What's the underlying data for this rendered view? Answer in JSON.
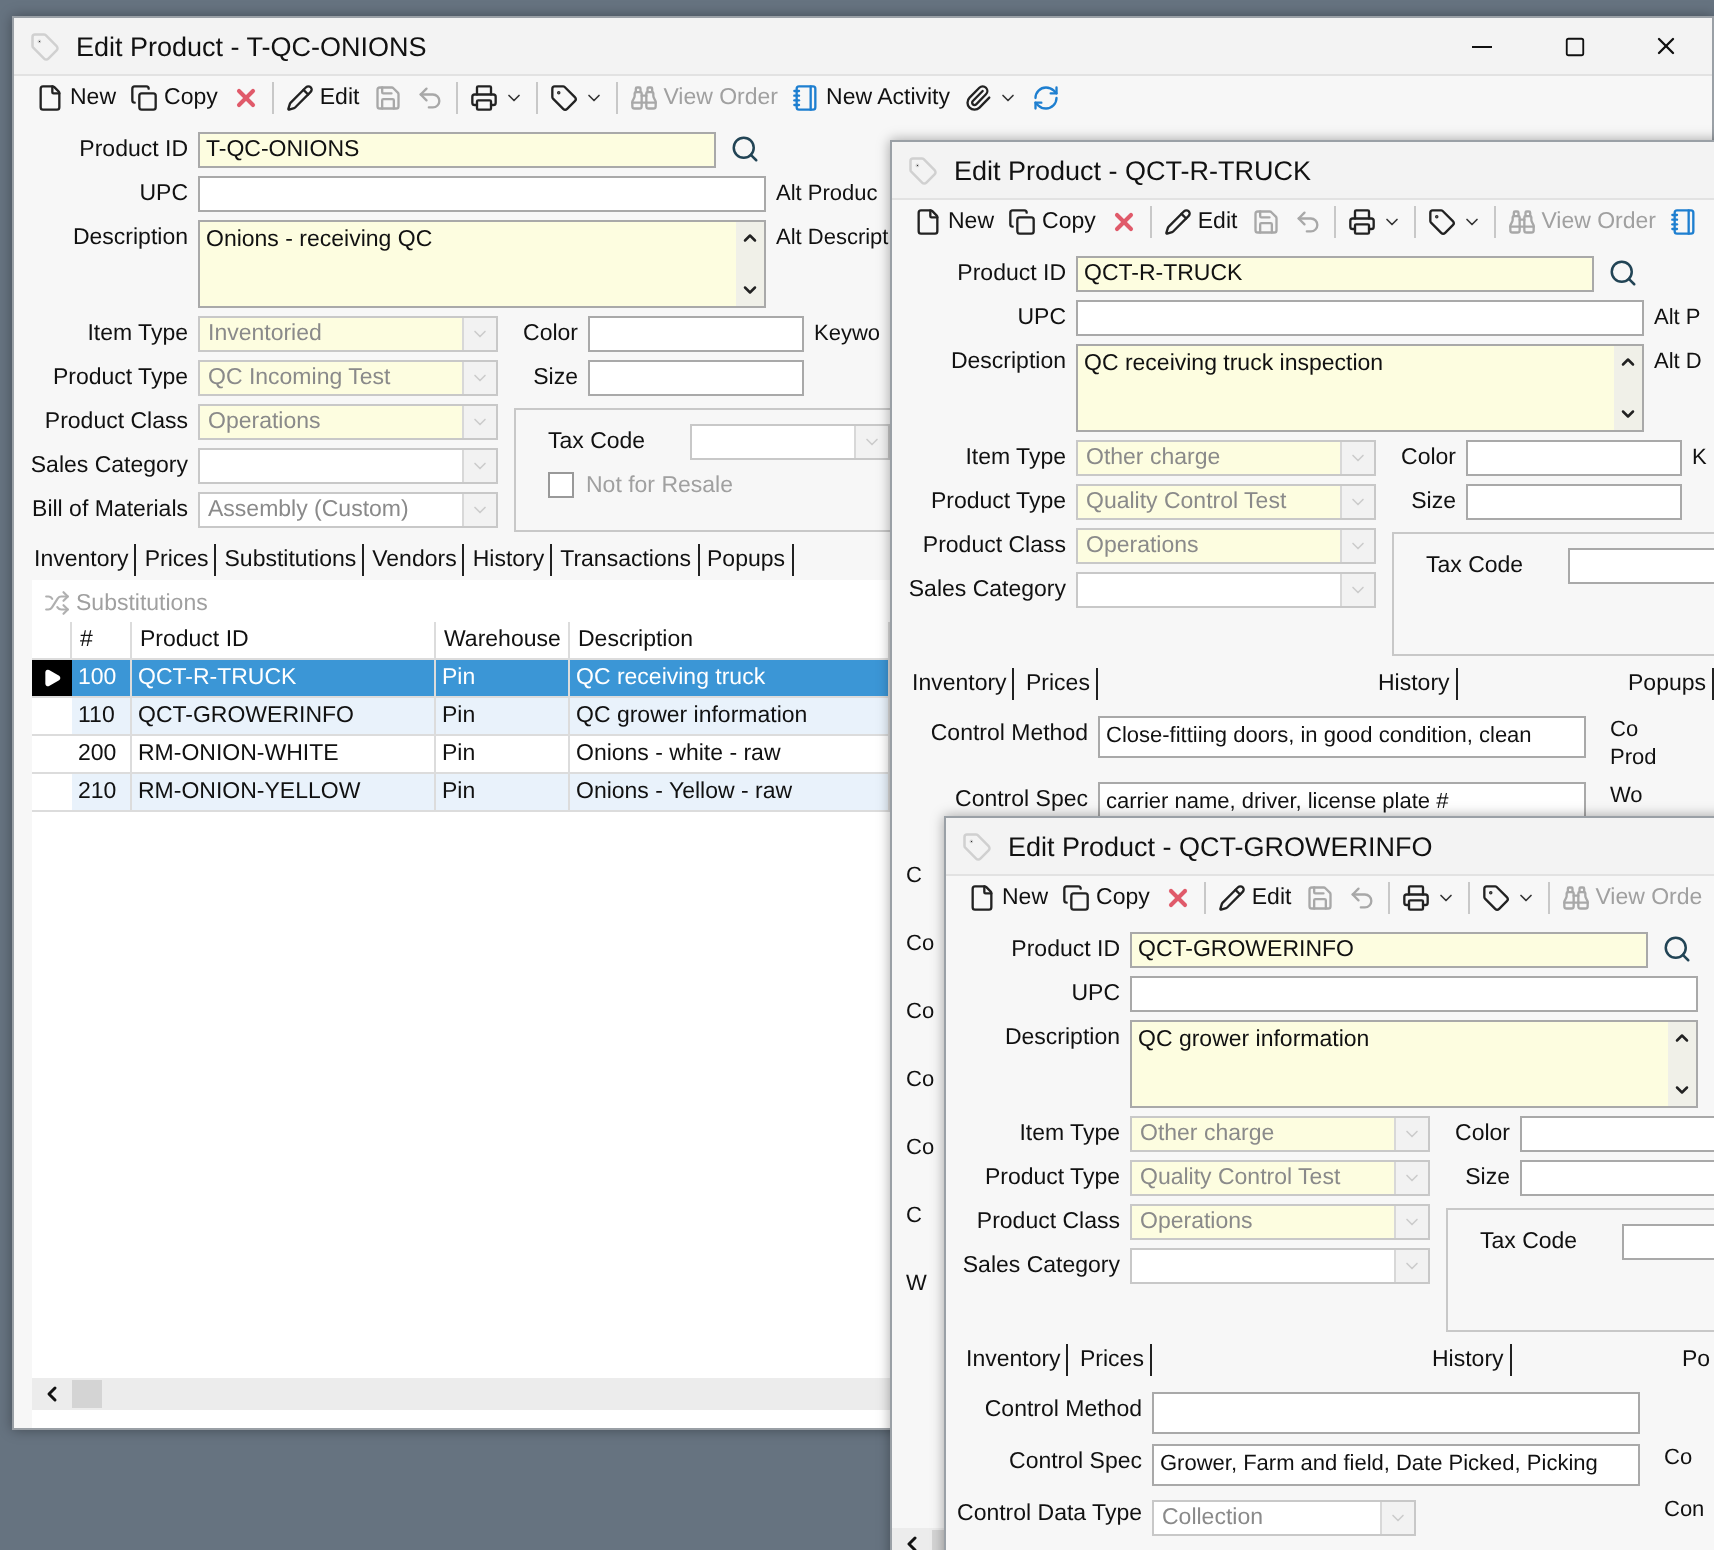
{
  "windows": [
    {
      "kind": "substitutions",
      "title": "Edit Product - T-QC-ONIONS",
      "caption_buttons": true,
      "h_scroll": true,
      "toolbar": [
        {
          "kind": "new",
          "label": "New",
          "disabled": false
        },
        {
          "kind": "copy",
          "label": "Copy",
          "disabled": false
        },
        {
          "kind": "delete",
          "disabled": false
        },
        {
          "kind": "edit",
          "label": "Edit",
          "disabled": false
        },
        {
          "kind": "save",
          "disabled": true
        },
        {
          "kind": "undo",
          "disabled": true
        },
        {
          "kind": "print",
          "disabled": false,
          "dropdown": true
        },
        {
          "kind": "tag",
          "disabled": false,
          "dropdown": true
        },
        {
          "kind": "view",
          "label": "View Order",
          "disabled": true
        },
        {
          "kind": "activity",
          "label": "New Activity",
          "disabled": false
        },
        {
          "kind": "attach",
          "disabled": false,
          "dropdown": true
        },
        {
          "kind": "refresh",
          "disabled": false
        }
      ],
      "form": {
        "product_id": {
          "label": "Product ID",
          "value": "T-QC-ONIONS"
        },
        "upc": {
          "label": "UPC",
          "side_label": "Alt Produc"
        },
        "description": {
          "label": "Description",
          "value": "Onions - receiving QC",
          "side_label": "Alt Descript"
        },
        "combos": [
          {
            "label": "Item Type",
            "value": "Inventoried",
            "required": true
          },
          {
            "label": "Product Type",
            "value": "QC Incoming Test",
            "required": true
          },
          {
            "label": "Product Class",
            "value": "Operations",
            "required": true
          },
          {
            "label": "Sales Category",
            "required": false
          },
          {
            "label": "Bill of Materials",
            "value": "Assembly (Custom)",
            "required": false
          }
        ],
        "color": {
          "label": "Color",
          "side_label": "Keywo"
        },
        "size": {
          "label": "Size"
        },
        "tax": {
          "label": "Tax Code",
          "button": true
        },
        "resale": {
          "label": "Not for Resale",
          "checked": false,
          "disabled": true
        }
      },
      "tabs": [
        {
          "label": "Inventory"
        },
        {
          "label": "Prices"
        },
        {
          "label": "Substitutions"
        },
        {
          "label": "Vendors"
        },
        {
          "label": "History"
        },
        {
          "label": "Transactions"
        },
        {
          "label": "Popups"
        }
      ],
      "grid": {
        "action": {
          "label": "Substitutions",
          "disabled": true
        },
        "columns": [
          "#",
          "Product ID",
          "Warehouse",
          "Description"
        ],
        "rows": [
          {
            "cells": [
              "100",
              "QCT-R-TRUCK",
              "Pin",
              "QC receiving truck"
            ],
            "selected": true
          },
          {
            "cells": [
              "110",
              "QCT-GROWERINFO",
              "Pin",
              "QC grower information"
            ],
            "selected": false
          },
          {
            "cells": [
              "200",
              "RM-ONION-WHITE",
              "Pin",
              "Onions - white - raw"
            ],
            "selected": false
          },
          {
            "cells": [
              "210",
              "RM-ONION-YELLOW",
              "Pin",
              "Onions - Yellow - raw"
            ],
            "selected": false
          }
        ]
      }
    },
    {
      "kind": "quality",
      "title": "Edit Product - QCT-R-TRUCK",
      "h_scroll": true,
      "toolbar": [
        {
          "kind": "new",
          "label": "New",
          "disabled": false
        },
        {
          "kind": "copy",
          "label": "Copy",
          "disabled": false
        },
        {
          "kind": "delete",
          "disabled": false
        },
        {
          "kind": "edit",
          "label": "Edit",
          "disabled": false
        },
        {
          "kind": "save",
          "disabled": true
        },
        {
          "kind": "undo",
          "disabled": true
        },
        {
          "kind": "print",
          "disabled": false,
          "dropdown": true
        },
        {
          "kind": "tag",
          "disabled": false,
          "dropdown": true
        },
        {
          "kind": "view",
          "label": "View Order",
          "disabled": true
        },
        {
          "kind": "activity",
          "disabled": false
        }
      ],
      "form": {
        "product_id": {
          "label": "Product ID",
          "value": "QCT-R-TRUCK"
        },
        "upc": {
          "label": "UPC",
          "side_label": "Alt P"
        },
        "description": {
          "label": "Description",
          "value": "QC receiving truck inspection",
          "side_label": "Alt D"
        },
        "combos": [
          {
            "label": "Item Type",
            "value": "Other charge",
            "required": true
          },
          {
            "label": "Product Type",
            "value": "Quality Control Test",
            "required": true
          },
          {
            "label": "Product Class",
            "value": "Operations",
            "required": true
          },
          {
            "label": "Sales Category",
            "required": false
          }
        ],
        "color": {
          "label": "Color",
          "side_label": "K"
        },
        "size": {
          "label": "Size"
        },
        "tax": {
          "label": "Tax Code",
          "button": false
        }
      },
      "tabs": [
        {
          "label": "Inventory"
        },
        {
          "label": "Prices"
        },
        {
          "label": "History"
        },
        {
          "label": "Popups"
        }
      ],
      "controls": [
        {
          "kind": "text",
          "label": "Control Method",
          "value": "Close-fittiing doors, in good condition, clean",
          "side_labels": [
            "Co",
            "Prod"
          ]
        },
        {
          "kind": "text",
          "label": "Control Spec",
          "value": "carrier name, driver, license plate #",
          "side_labels": [
            "Wo"
          ]
        }
      ],
      "covered_labels": [
        "C",
        "Co",
        "Co",
        "Co",
        "Co",
        "C",
        "W"
      ]
    },
    {
      "kind": "quality",
      "title": "Edit Product - QCT-GROWERINFO",
      "toolbar": [
        {
          "kind": "new",
          "label": "New",
          "disabled": false
        },
        {
          "kind": "copy",
          "label": "Copy",
          "disabled": false
        },
        {
          "kind": "delete",
          "disabled": false
        },
        {
          "kind": "edit",
          "label": "Edit",
          "disabled": false
        },
        {
          "kind": "save",
          "disabled": true
        },
        {
          "kind": "undo",
          "disabled": true
        },
        {
          "kind": "print",
          "disabled": false,
          "dropdown": true
        },
        {
          "kind": "tag",
          "disabled": false,
          "dropdown": true
        },
        {
          "kind": "view",
          "label": "View Orde",
          "disabled": true
        }
      ],
      "form": {
        "product_id": {
          "label": "Product ID",
          "value": "QCT-GROWERINFO"
        },
        "upc": {
          "label": "UPC"
        },
        "description": {
          "label": "Description",
          "value": "QC grower information"
        },
        "combos": [
          {
            "label": "Item Type",
            "value": "Other charge",
            "required": true
          },
          {
            "label": "Product Type",
            "value": "Quality Control Test",
            "required": true
          },
          {
            "label": "Product Class",
            "value": "Operations",
            "required": true
          },
          {
            "label": "Sales Category",
            "required": false
          }
        ],
        "color": {
          "label": "Color"
        },
        "size": {
          "label": "Size"
        },
        "tax": {
          "label": "Tax Code",
          "button": false
        }
      },
      "tabs": [
        {
          "label": "Inventory"
        },
        {
          "label": "Prices"
        },
        {
          "label": "History"
        },
        {
          "label": "Po"
        }
      ],
      "controls": [
        {
          "kind": "text",
          "label": "Control Method"
        },
        {
          "kind": "text",
          "label": "Control Spec",
          "value": "Grower, Farm and field, Date Picked, Picking",
          "side_labels": [
            "Co"
          ]
        },
        {
          "kind": "combo",
          "label": "Control Data Type",
          "value": "Collection",
          "side_labels": [
            "Con"
          ]
        }
      ]
    }
  ]
}
